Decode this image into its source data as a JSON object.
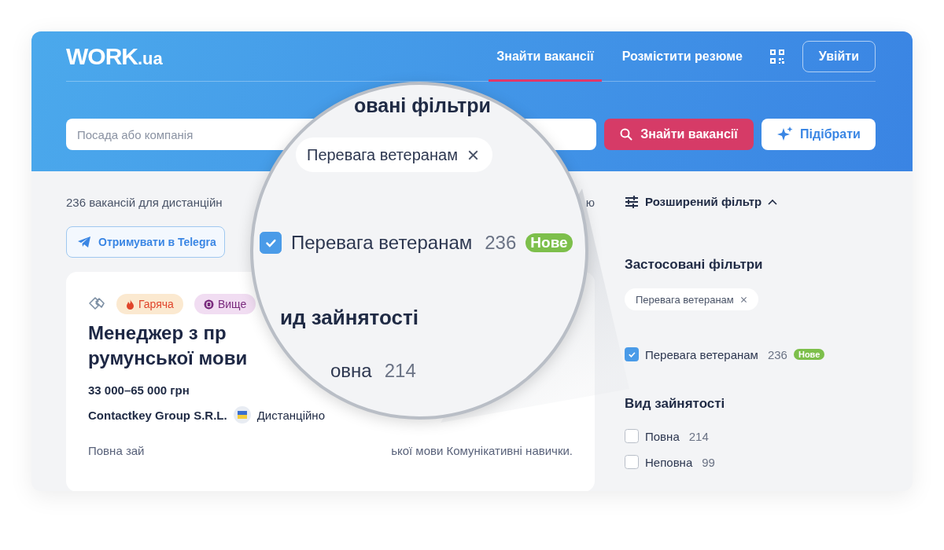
{
  "header": {
    "logo": {
      "main": "WORK",
      "suffix": ".ua"
    },
    "nav": [
      {
        "label": "Знайти вакансії",
        "selected": true
      },
      {
        "label": "Розмістити резюме",
        "selected": false
      }
    ],
    "login_button": "Увійти",
    "search": {
      "placeholder": "Посада або компанія",
      "search_button": "Знайти вакансії",
      "pick_button": "Підібрати"
    }
  },
  "results": {
    "count_text": "236 вакансій для дистанційн",
    "count_tail": "ю",
    "telegram_button": "Отримувати в Telegra",
    "job": {
      "tags": [
        {
          "label": "Гаряча",
          "kind": "hot"
        },
        {
          "label": "Вище",
          "kind": "higher"
        }
      ],
      "title_lines": [
        "Менеджер з пр",
        "румунської мови"
      ],
      "salary": "33 000–65 000 грн",
      "company": "Contactkey Group S.R.L.",
      "location": "Дистанційно",
      "description_start": "Повна зай",
      "description_end": "ької мови Комунікативні навички."
    }
  },
  "sidebar": {
    "toggle": {
      "label": "Розширений фільтр",
      "expanded": true
    },
    "applied_title": "Застосовані фільтри",
    "applied_chips": [
      "Перевага ветеранам"
    ],
    "veteran_option": {
      "label": "Перевага ветеранам",
      "count": "236",
      "badge": "Нове",
      "checked": true
    },
    "employment_title": "Вид зайнятості",
    "employment_options": [
      {
        "label": "Повна",
        "count": "214",
        "checked": false
      },
      {
        "label": "Неповна",
        "count": "99",
        "checked": false
      }
    ]
  },
  "magnifier": {
    "title": "овані фільтри",
    "chip": "Перевага ветеранам",
    "option": {
      "label": "Перевага ветеранам",
      "count": "236",
      "badge": "Нове",
      "checked": true
    },
    "section_title": "ид зайнятості",
    "partial_option": {
      "label": "овна",
      "count": "214"
    }
  }
}
